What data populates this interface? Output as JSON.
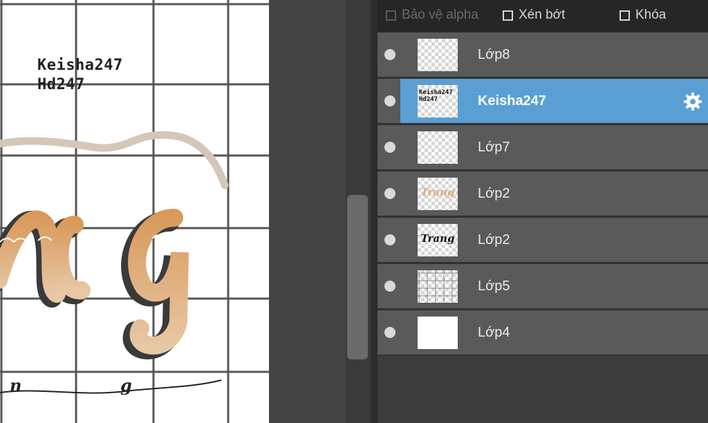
{
  "canvas": {
    "text_line1": "Keisha247",
    "text_line2": "Hd247"
  },
  "options_bar": {
    "protect_alpha": "Bảo vệ alpha",
    "clipping": "Xén bớt",
    "lock": "Khóa"
  },
  "layers": [
    {
      "name": "Lớp8",
      "selected": false
    },
    {
      "name": "Keisha247",
      "selected": true,
      "thumb_text": "Keisha247\nHd247"
    },
    {
      "name": "Lớp7",
      "selected": false
    },
    {
      "name": "Lớp2",
      "selected": false,
      "thumb_script": "Trang",
      "thumb_color": "#e0a878"
    },
    {
      "name": "Lớp2",
      "selected": false,
      "thumb_script": "Trang",
      "thumb_color": "#111111"
    },
    {
      "name": "Lớp5",
      "selected": false
    },
    {
      "name": "Lớp4",
      "selected": false
    }
  ],
  "colors": {
    "selection": "#5a9fd4",
    "panel_bg": "#3c3c3c",
    "layer_bg": "#5a5a5a"
  },
  "icons": {
    "visibility": "visibility-dot-icon",
    "settings": "gear-icon",
    "checkbox": "checkbox-icon"
  }
}
